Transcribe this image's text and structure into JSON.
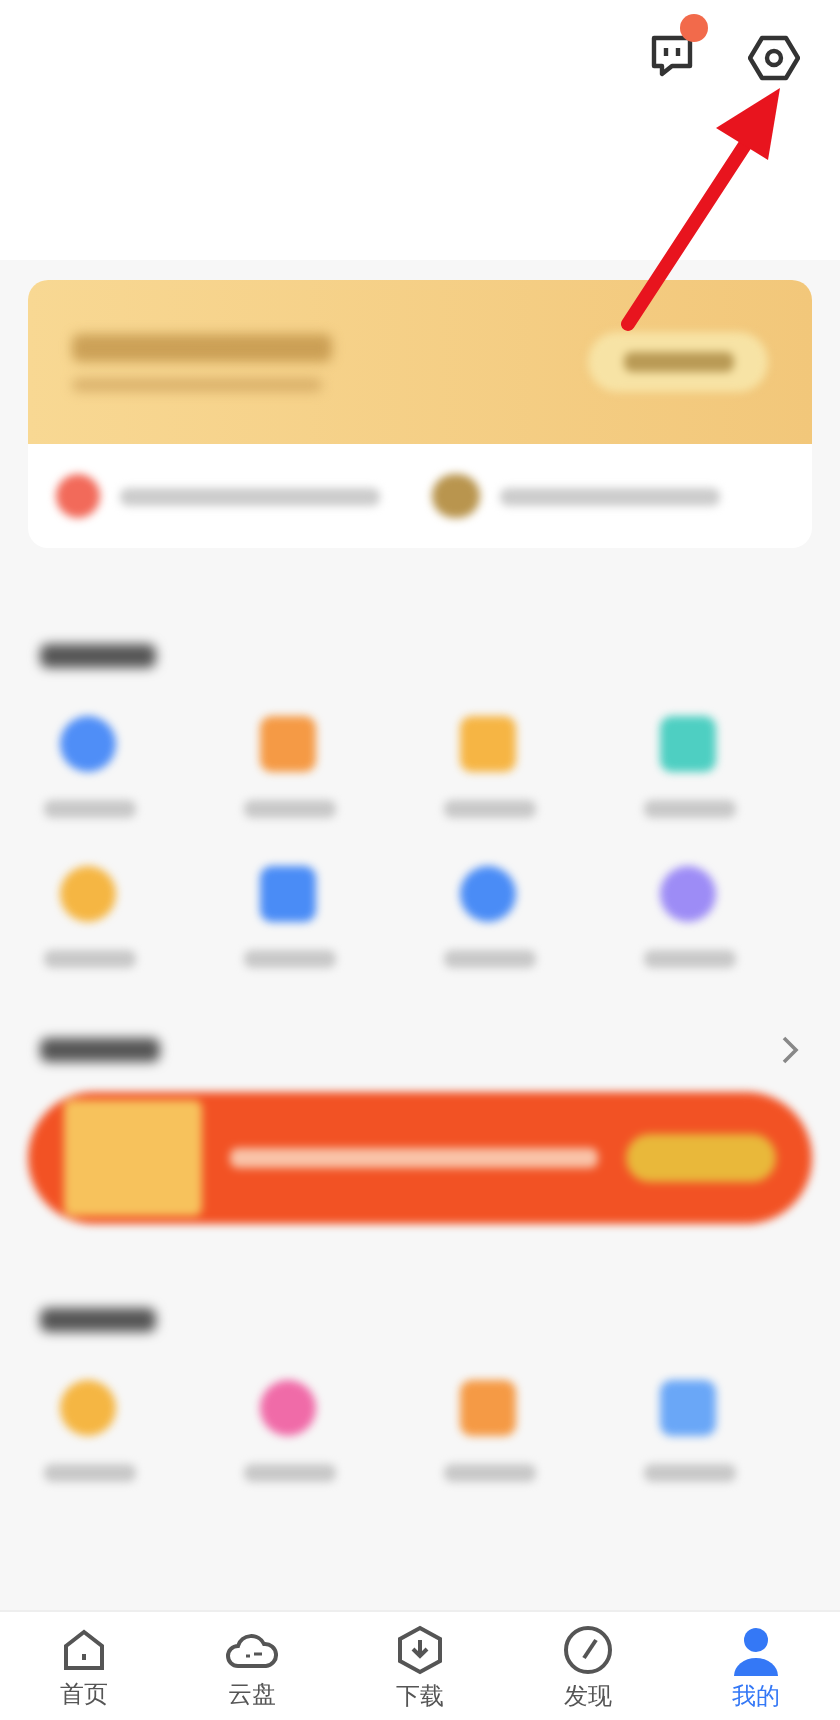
{
  "top_bar": {
    "messages_unread": true
  },
  "nav": [
    {
      "label": "首页",
      "selected": false
    },
    {
      "label": "云盘",
      "selected": false
    },
    {
      "label": "下载",
      "selected": false
    },
    {
      "label": "发现",
      "selected": false
    },
    {
      "label": "我的",
      "selected": true
    }
  ]
}
